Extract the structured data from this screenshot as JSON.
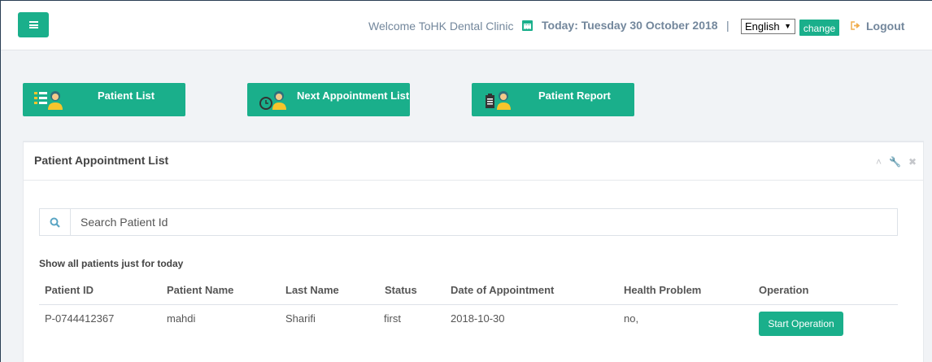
{
  "header": {
    "welcome": "Welcome ToHK Dental Clinic",
    "today": "Today: Tuesday 30 October 2018",
    "separator": "|",
    "language": "English",
    "change_label": "change",
    "logout_label": "Logout"
  },
  "quick_actions": [
    {
      "label": "Patient List"
    },
    {
      "label": "Next Appointment List"
    },
    {
      "label": "Patient Report"
    }
  ],
  "panel": {
    "title": "Patient Appointment List",
    "search_placeholder": "Search Patient Id",
    "note": "Show all patients just for today"
  },
  "table": {
    "headers": [
      "Patient ID",
      "Patient Name",
      "Last Name",
      "Status",
      "Date of Appointment",
      "Health Problem",
      "Operation"
    ],
    "rows": [
      {
        "patient_id": "P-0744412367",
        "patient_name": "mahdi",
        "last_name": "Sharifi",
        "status": "first",
        "date": "2018-10-30",
        "health_problem": "no,",
        "operation_label": "Start Operation"
      }
    ]
  },
  "colors": {
    "accent": "#1aaf8b",
    "text_muted": "#73879c"
  }
}
